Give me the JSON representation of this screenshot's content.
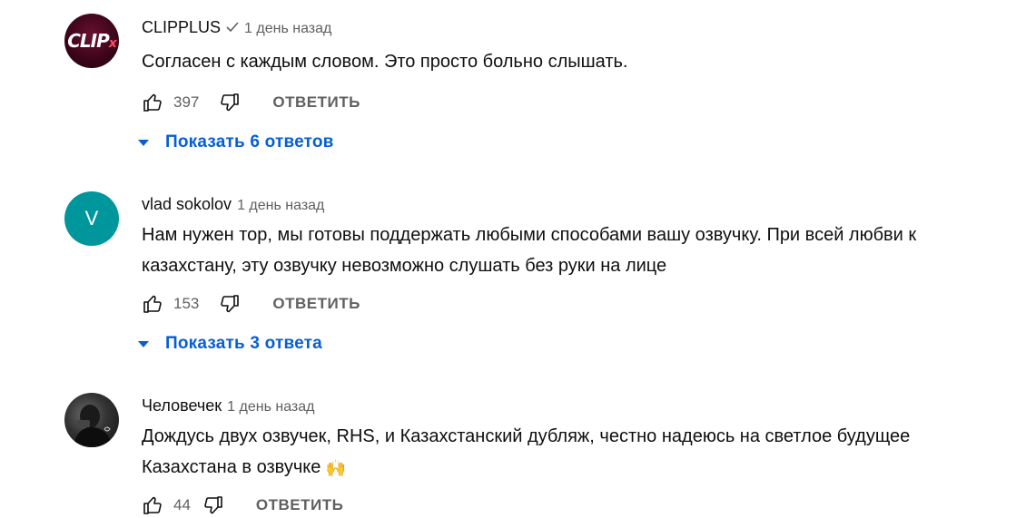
{
  "comments": [
    {
      "author": "CLIPPLUS",
      "verified": true,
      "time": "1 день назад",
      "text": "Согласен с каждым словом. Это просто больно слышать.",
      "likes": "397",
      "reply_label": "ОТВЕТИТЬ",
      "show_replies": "Показать 6 ответов",
      "avatar_text": "CLIP",
      "avatar_suffix": "x"
    },
    {
      "author": "vlad sokolov",
      "verified": false,
      "time": "1 день назад",
      "text": "Нам нужен тор, мы готовы поддержать любыми способами вашу озвучку. При всей любви к казахстану, эту озвучку невозможно слушать без руки на лице",
      "likes": "153",
      "reply_label": "ОТВЕТИТЬ",
      "show_replies": "Показать 3 ответа",
      "avatar_letter": "V",
      "avatar_color": "#00979c"
    },
    {
      "author": "Человечек",
      "verified": false,
      "time": "1 день назад",
      "text": "Дождусь двух озвучек, RHS, и Казахстанский дубляж, честно надеюсь на светлое будущее Казахстана в озвучке",
      "emoji": "🙌",
      "likes": "44",
      "reply_label": "ОТВЕТИТЬ"
    }
  ],
  "colors": {
    "link": "#065fd4",
    "secondary": "#606060",
    "text": "#0f0f0f"
  }
}
